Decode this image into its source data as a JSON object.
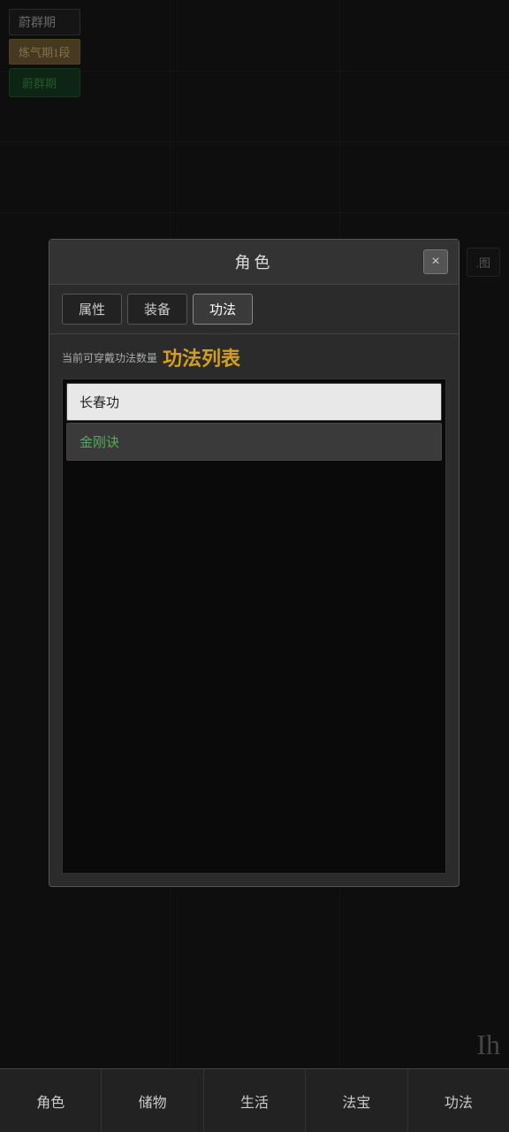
{
  "app": {
    "title": "角色",
    "close_label": "×"
  },
  "top_ui": {
    "name": "蔚群期",
    "rank": "炼气期1段",
    "action_btn": "蔚群期"
  },
  "tabs": [
    {
      "id": "attributes",
      "label": "属性"
    },
    {
      "id": "equipment",
      "label": "装备"
    },
    {
      "id": "skills",
      "label": "功法",
      "active": true
    }
  ],
  "skill_list": {
    "header_small": "当前可穿戴功法数量",
    "header_title": "功法列表",
    "items": [
      {
        "name": "长春功",
        "style": "normal"
      },
      {
        "name": "金刚诀",
        "style": "green"
      }
    ]
  },
  "minimap": {
    "label": ".图"
  },
  "bottom_nav": [
    {
      "id": "character",
      "label": "角色"
    },
    {
      "id": "storage",
      "label": "储物"
    },
    {
      "id": "life",
      "label": "生活"
    },
    {
      "id": "treasure",
      "label": "法宝"
    },
    {
      "id": "skills",
      "label": "功法"
    }
  ],
  "ih_text": "Ih",
  "colors": {
    "accent_gold": "#d4a017",
    "accent_green": "#4caf50",
    "bg_dark": "#1a1a1a",
    "modal_bg": "#2b2b2b"
  }
}
